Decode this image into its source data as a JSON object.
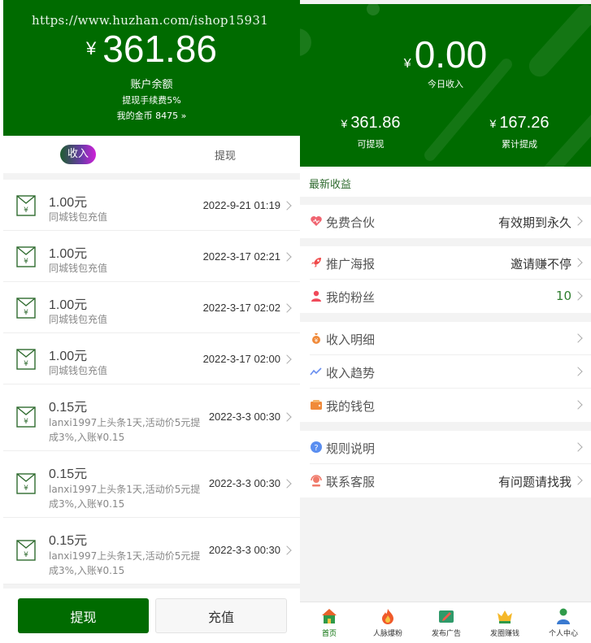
{
  "left": {
    "watermark": "https://www.huzhan.com/ishop15931",
    "currency": "¥",
    "balance": "361.86",
    "balance_label": "账户余额",
    "fee_text": "提现手续费5%",
    "coins_text": "我的金币 8475 »",
    "tabs": {
      "income": "收入",
      "withdraw": "提现"
    },
    "records": [
      {
        "amount": "1.00元",
        "desc": "同城钱包充值",
        "datetime": "2022-9-21 01:19"
      },
      {
        "amount": "1.00元",
        "desc": "同城钱包充值",
        "datetime": "2022-3-17 02:21"
      },
      {
        "amount": "1.00元",
        "desc": "同城钱包充值",
        "datetime": "2022-3-17 02:02"
      },
      {
        "amount": "1.00元",
        "desc": "同城钱包充值",
        "datetime": "2022-3-17 02:00"
      },
      {
        "amount": "0.15元",
        "desc": "lanxi1997上头条1天,活动价5元提成3%,入账¥0.15",
        "datetime": "2022-3-3 00:30"
      },
      {
        "amount": "0.15元",
        "desc": "lanxi1997上头条1天,活动价5元提成3%,入账¥0.15",
        "datetime": "2022-3-3 00:30"
      },
      {
        "amount": "0.15元",
        "desc": "lanxi1997上头条1天,活动价5元提成3%,入账¥0.15",
        "datetime": "2022-3-3 00:30"
      }
    ],
    "buttons": {
      "withdraw": "提现",
      "recharge": "充值"
    }
  },
  "right": {
    "currency": "¥",
    "today_amount": "0.00",
    "today_label": "今日收入",
    "withdrawable_amount": "361.86",
    "withdrawable_label": "可提现",
    "total_amount": "167.26",
    "total_label": "累计提成",
    "latest_title": "最新收益",
    "menu": {
      "partner": {
        "label": "免费合伙",
        "value": "有效期到永久",
        "icon": "heart-icon"
      },
      "poster": {
        "label": "推广海报",
        "value": "邀请赚不停",
        "icon": "rocket-icon"
      },
      "fans": {
        "label": "我的粉丝",
        "value": "10",
        "icon": "user-icon"
      },
      "detail": {
        "label": "收入明细",
        "icon": "money-bag-icon"
      },
      "trend": {
        "label": "收入趋势",
        "icon": "trend-icon"
      },
      "wallet": {
        "label": "我的钱包",
        "icon": "wallet-icon"
      },
      "rules": {
        "label": "规则说明",
        "icon": "question-icon"
      },
      "service": {
        "label": "联系客服",
        "value": "有问题请找我",
        "icon": "headset-icon"
      }
    },
    "tabbar": [
      {
        "label": "首页",
        "icon": "home-icon"
      },
      {
        "label": "人脉爆粉",
        "icon": "fire-icon"
      },
      {
        "label": "发布广告",
        "icon": "publish-icon"
      },
      {
        "label": "发圈赚钱",
        "icon": "crown-icon"
      },
      {
        "label": "个人中心",
        "icon": "person-icon"
      }
    ],
    "colors": {
      "brand_green": "#006b00"
    }
  }
}
